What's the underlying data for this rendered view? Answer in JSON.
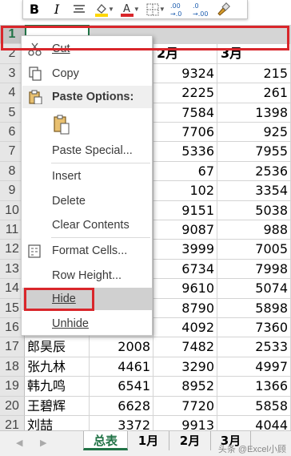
{
  "toolbar": {
    "bold": "B",
    "italic": "I",
    "increase_decimal": ".00\n→.0",
    "decrease_decimal": "→.00",
    "fill_color": "#ffd700",
    "font_color": "#d9262b"
  },
  "grid": {
    "active_cell_value": "",
    "rows": [
      {
        "num": "1",
        "a": "",
        "b": "",
        "c": "",
        "d": "",
        "selected": true
      },
      {
        "num": "2",
        "a": "",
        "b": "",
        "c": "2月",
        "d": "3月"
      },
      {
        "num": "3",
        "a": "",
        "b": "",
        "c": "9324",
        "d": "215"
      },
      {
        "num": "4",
        "a": "",
        "b": "",
        "c": "2225",
        "d": "261"
      },
      {
        "num": "5",
        "a": "",
        "b": "",
        "c": "7584",
        "d": "1398"
      },
      {
        "num": "6",
        "a": "",
        "b": "",
        "c": "7706",
        "d": "925"
      },
      {
        "num": "7",
        "a": "",
        "b": "",
        "c": "5336",
        "d": "7955"
      },
      {
        "num": "8",
        "a": "",
        "b": "",
        "c": "67",
        "d": "2536"
      },
      {
        "num": "9",
        "a": "",
        "b": "",
        "c": "102",
        "d": "3354"
      },
      {
        "num": "10",
        "a": "",
        "b": "",
        "c": "9151",
        "d": "5038"
      },
      {
        "num": "11",
        "a": "",
        "b": "",
        "c": "9087",
        "d": "988"
      },
      {
        "num": "12",
        "a": "",
        "b": "",
        "c": "3999",
        "d": "7005"
      },
      {
        "num": "13",
        "a": "",
        "b": "",
        "c": "6734",
        "d": "7998"
      },
      {
        "num": "14",
        "a": "",
        "b": "",
        "c": "9610",
        "d": "5074"
      },
      {
        "num": "15",
        "a": "",
        "b": "",
        "c": "8790",
        "d": "5898"
      },
      {
        "num": "16",
        "a": "",
        "b": "",
        "c": "4092",
        "d": "7360"
      },
      {
        "num": "17",
        "a": "郎昊辰",
        "b": "2008",
        "c": "7482",
        "d": "2533"
      },
      {
        "num": "18",
        "a": "张九林",
        "b": "4461",
        "c": "3290",
        "d": "4997"
      },
      {
        "num": "19",
        "a": "韩九鸣",
        "b": "6541",
        "c": "8952",
        "d": "1366"
      },
      {
        "num": "20",
        "a": "王碧辉",
        "b": "6628",
        "c": "7720",
        "d": "5858"
      },
      {
        "num": "21",
        "a": "刘喆",
        "b": "3372",
        "c": "9913",
        "d": "4044"
      }
    ]
  },
  "context_menu": {
    "cut": "Cut",
    "copy": "Copy",
    "paste_options": "Paste Options:",
    "paste_special": "Paste Special...",
    "insert": "Insert",
    "delete": "Delete",
    "clear_contents": "Clear Contents",
    "format_cells": "Format Cells...",
    "row_height": "Row Height...",
    "hide": "Hide",
    "unhide": "Unhide"
  },
  "sheet_tabs": {
    "tabs": [
      "总表",
      "1月",
      "2月",
      "3月"
    ],
    "active": "总表",
    "watermark": "头条 @Excel小顾"
  },
  "colors": {
    "excel_green": "#217346",
    "highlight_red": "#d9262b"
  }
}
